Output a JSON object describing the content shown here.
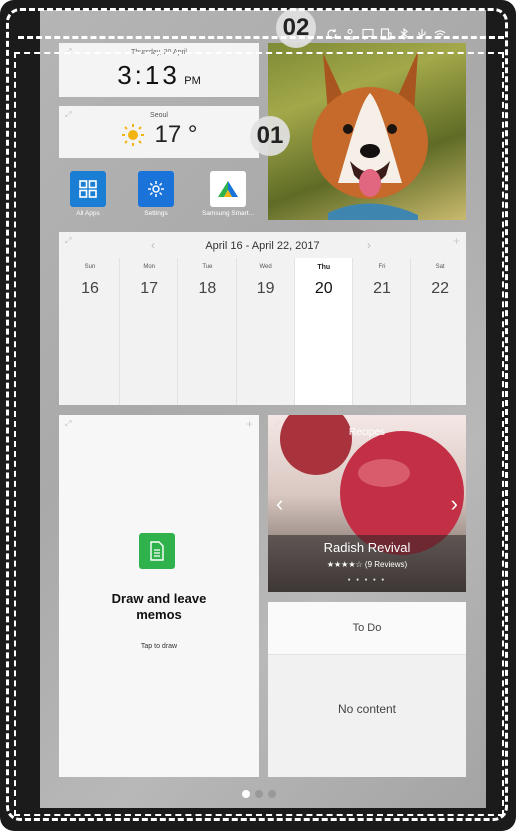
{
  "callouts": {
    "status_bar": "02",
    "main_area": "01"
  },
  "status_icons": [
    "sync-icon",
    "person-icon",
    "chat-icon",
    "building-icon",
    "bluetooth-icon",
    "usb-icon",
    "wifi-icon"
  ],
  "clock": {
    "date": "Thursday, 20 April",
    "time": "3:13",
    "ampm": "PM"
  },
  "weather": {
    "city": "Seoul",
    "temp": "17 °",
    "icon": "sun-icon"
  },
  "apps": [
    {
      "label": "All Apps",
      "icon": "grid-icon",
      "color": "#1a7fd4"
    },
    {
      "label": "Settings",
      "icon": "gear-icon",
      "color": "#1a73d9"
    },
    {
      "label": "Samsung Smart...",
      "icon": "smartthings-icon",
      "color": "#ffffff"
    }
  ],
  "calendar": {
    "range": "April 16 - April 22, 2017",
    "days": [
      {
        "name": "Sun",
        "date": "16"
      },
      {
        "name": "Mon",
        "date": "17"
      },
      {
        "name": "Tue",
        "date": "18"
      },
      {
        "name": "Wed",
        "date": "19"
      },
      {
        "name": "Thu",
        "date": "20"
      },
      {
        "name": "Fri",
        "date": "21"
      },
      {
        "name": "Sat",
        "date": "22"
      }
    ],
    "selected_index": 4
  },
  "memo": {
    "title": "Draw and leave memos",
    "subtitle": "Tap to draw"
  },
  "recipes": {
    "header": "Recipes",
    "name": "Radish Revival",
    "stars": "★★★★☆",
    "reviews": "(9 Reviews)"
  },
  "todo": {
    "header": "To Do",
    "empty": "No content"
  },
  "colors": {
    "accent_green": "#2fb24c",
    "accent_blue": "#1a73d9"
  }
}
